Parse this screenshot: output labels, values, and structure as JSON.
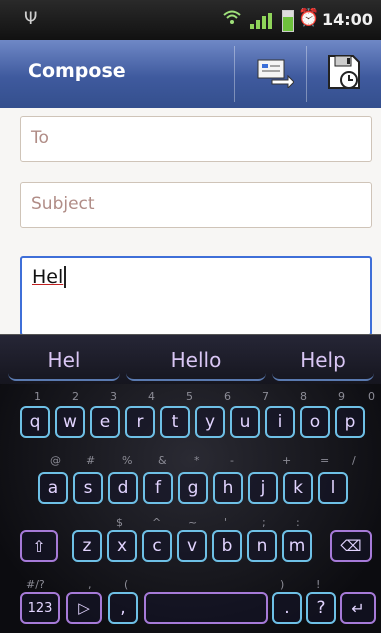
{
  "status_bar": {
    "time": "14:00",
    "icons": [
      "usb-icon",
      "wifi-icon",
      "signal-icon",
      "battery-icon",
      "alarm-icon"
    ]
  },
  "titlebar": {
    "title": "Compose",
    "actions": [
      "send-icon",
      "save-icon"
    ]
  },
  "compose": {
    "to_placeholder": "To",
    "subject_placeholder": "Subject",
    "body_text": "Hel"
  },
  "suggestions": [
    "Hel",
    "Hello",
    "Help"
  ],
  "keyboard": {
    "row1_digits": [
      "1",
      "2",
      "3",
      "4",
      "5",
      "6",
      "7",
      "8",
      "9",
      "0"
    ],
    "row1_letters": [
      "q",
      "w",
      "e",
      "r",
      "t",
      "y",
      "u",
      "i",
      "o",
      "p"
    ],
    "row2_symbols": [
      "@",
      "#",
      "%",
      "&",
      "*",
      "-",
      "+",
      "=",
      "/"
    ],
    "row2_letters": [
      "a",
      "s",
      "d",
      "f",
      "g",
      "h",
      "j",
      "k",
      "l"
    ],
    "row3_symbols": [
      "$",
      "^",
      "~",
      "'",
      ";",
      ":"
    ],
    "row3_letters": [
      "z",
      "x",
      "c",
      "v",
      "b",
      "n",
      "m"
    ],
    "row4_symbols": [
      "#/?",
      ",",
      "(",
      ")",
      "!"
    ],
    "symbols_key": "123",
    "comma_key": ",",
    "period_key": ".",
    "question_key": "?"
  },
  "colors": {
    "titlebar": "#4a64a8",
    "key_border": "#6ec0e6",
    "key_text": "#e2d4ff",
    "suggestion_text": "#d9c6f4"
  }
}
